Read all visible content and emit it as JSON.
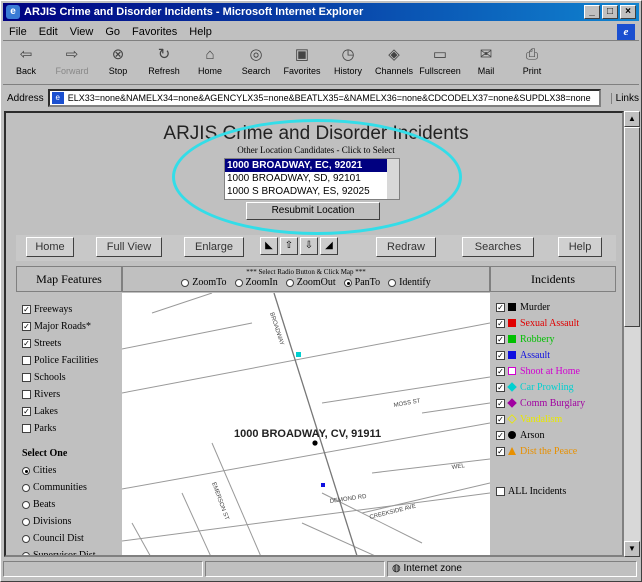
{
  "window": {
    "title": "ARJIS Crime and Disorder Incidents - Microsoft Internet Explorer"
  },
  "menu": [
    "File",
    "Edit",
    "View",
    "Go",
    "Favorites",
    "Help"
  ],
  "toolbar": [
    {
      "label": "Back",
      "icon": "back-arrow-icon",
      "glyph": "⇦",
      "disabled": false
    },
    {
      "label": "Forward",
      "icon": "forward-arrow-icon",
      "glyph": "⇨",
      "disabled": true
    },
    {
      "label": "Stop",
      "icon": "stop-icon",
      "glyph": "⊗",
      "disabled": false
    },
    {
      "label": "Refresh",
      "icon": "refresh-icon",
      "glyph": "↻",
      "disabled": false
    },
    {
      "label": "Home",
      "icon": "home-icon",
      "glyph": "⌂",
      "disabled": false
    },
    {
      "label": "Search",
      "icon": "search-icon",
      "glyph": "◎",
      "disabled": false
    },
    {
      "label": "Favorites",
      "icon": "favorites-icon",
      "glyph": "▣",
      "disabled": false
    },
    {
      "label": "History",
      "icon": "history-icon",
      "glyph": "◷",
      "disabled": false
    },
    {
      "label": "Channels",
      "icon": "channels-icon",
      "glyph": "◈",
      "disabled": false
    },
    {
      "label": "Fullscreen",
      "icon": "fullscreen-icon",
      "glyph": "▭",
      "disabled": false
    },
    {
      "label": "Mail",
      "icon": "mail-icon",
      "glyph": "✉",
      "disabled": false
    },
    {
      "label": "Print",
      "icon": "print-icon",
      "glyph": "⎙",
      "disabled": false
    }
  ],
  "address": {
    "label": "Address",
    "url": "ELX33=none&NAMELX34=none&AGENCYLX35=none&BEATLX35=&NAMELX36=none&CDCODELX37=none&SUPDLX38=none",
    "links": "Links"
  },
  "page": {
    "title": "ARJIS Crime and Disorder Incidents",
    "subtitle": "Other Location Candidates - Click to Select",
    "candidates": [
      "1000 BROADWAY, EC, 92021",
      "1000 BROADWAY, SD, 92101",
      "1000 S BROADWAY, ES, 92025"
    ],
    "resubmit": "Resubmit Location"
  },
  "nav": {
    "home": "Home",
    "fullview": "Full View",
    "enlarge": "Enlarge",
    "redraw": "Redraw",
    "searches": "Searches",
    "help": "Help"
  },
  "map_features": {
    "title": "Map Features",
    "layers": [
      {
        "label": "Freeways",
        "checked": true
      },
      {
        "label": "Major Roads*",
        "checked": true
      },
      {
        "label": "Streets",
        "checked": true
      },
      {
        "label": "Police Facilities",
        "checked": false
      },
      {
        "label": "Schools",
        "checked": false
      },
      {
        "label": "Rivers",
        "checked": false
      },
      {
        "label": "Lakes",
        "checked": true
      },
      {
        "label": "Parks",
        "checked": false
      }
    ],
    "select_one": "Select One",
    "options": [
      {
        "label": "Cities",
        "selected": true
      },
      {
        "label": "Communities",
        "selected": false
      },
      {
        "label": "Beats",
        "selected": false
      },
      {
        "label": "Divisions",
        "selected": false
      },
      {
        "label": "Council Dist",
        "selected": false
      },
      {
        "label": "Supervisor Dist",
        "selected": false
      }
    ]
  },
  "map_tools": {
    "instruction": "*** Select Radio Button & Click Map ***",
    "options": [
      {
        "label": "ZoomTo",
        "selected": false
      },
      {
        "label": "ZoomIn",
        "selected": false
      },
      {
        "label": "ZoomOut",
        "selected": false
      },
      {
        "label": "PanTo",
        "selected": true
      },
      {
        "label": "Identify",
        "selected": false
      }
    ]
  },
  "map": {
    "location_label": "1000 BROADWAY, CV, 91911",
    "street_labels": [
      "MOSS ST",
      "BROADWAY",
      "DEMOND RD",
      "CREEKSIDE AVE",
      "EMERSON ST",
      "WEL"
    ]
  },
  "incidents": {
    "title": "Incidents",
    "items": [
      {
        "label": "Murder",
        "checked": true,
        "color": "#000000",
        "shape": "square"
      },
      {
        "label": "Sexual Assault",
        "checked": true,
        "color": "#e00000",
        "shape": "square"
      },
      {
        "label": "Robbery",
        "checked": true,
        "color": "#00c000",
        "shape": "square"
      },
      {
        "label": "Assault",
        "checked": true,
        "color": "#1010e0",
        "shape": "square"
      },
      {
        "label": "Shoot at Home",
        "checked": true,
        "color": "#d000d0",
        "shape": "square-outline"
      },
      {
        "label": "Car Prowling",
        "checked": true,
        "color": "#00d0d0",
        "shape": "diamond"
      },
      {
        "label": "Comm Burglary",
        "checked": true,
        "color": "#a000a0",
        "shape": "diamond"
      },
      {
        "label": "Vandalism",
        "checked": true,
        "color": "#e8e800",
        "shape": "diamond-outline"
      },
      {
        "label": "Arson",
        "checked": true,
        "color": "#000000",
        "shape": "circle"
      },
      {
        "label": "Dist the Peace",
        "checked": true,
        "color": "#e89000",
        "shape": "triangle"
      }
    ],
    "all_label": "ALL Incidents",
    "all_checked": false
  },
  "status": {
    "zone": "Internet zone"
  }
}
